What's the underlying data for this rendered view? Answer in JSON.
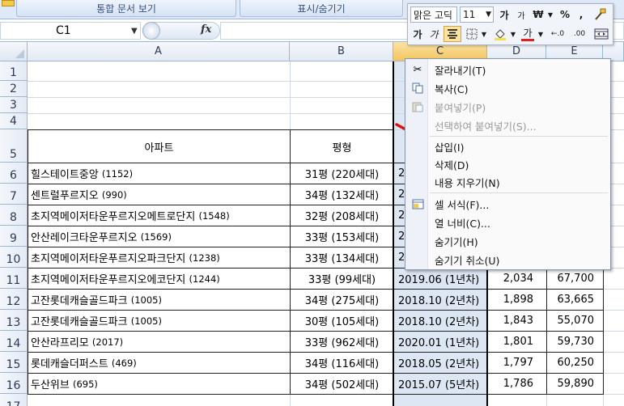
{
  "ribbon": {
    "btn_merge_docs": "통합 문서 보기",
    "btn_show_hide": "표시/숨기기"
  },
  "formula_bar": {
    "cell_ref": "C1",
    "fx": "fx",
    "formula": ""
  },
  "columns": [
    "A",
    "B",
    "C",
    "D",
    "E"
  ],
  "rows": [
    "1",
    "2",
    "3",
    "4",
    "5",
    "6",
    "7",
    "8",
    "9",
    "10",
    "11",
    "12",
    "13",
    "14",
    "15",
    "16",
    "17"
  ],
  "table": {
    "header_apt": "아파트",
    "header_size": "평형",
    "rows": [
      {
        "apt": "힐스테이트중앙",
        "count": "(1152)",
        "size": "31평 (220세대)",
        "date": "20",
        "d": "",
        "e": ""
      },
      {
        "apt": "센트럴푸르지오",
        "count": "(990)",
        "size": "34평 (132세대)",
        "date": "20",
        "d": "",
        "e": ""
      },
      {
        "apt": "초지역메이저타운푸르지오메트로단지",
        "count": "(1548)",
        "size": "32평 (208세대)",
        "date": "20",
        "d": "",
        "e": ""
      },
      {
        "apt": "안산레이크타운푸르지오",
        "count": "(1569)",
        "size": "33평 (153세대)",
        "date": "20",
        "d": "",
        "e": ""
      },
      {
        "apt": "초지역메이저타운푸르지오파크단지",
        "count": "(1238)",
        "size": "33평 (134세대)",
        "date": "20",
        "d": "",
        "e": ""
      },
      {
        "apt": "초지역메이저타운푸르지오에코단지",
        "count": "(1244)",
        "size": "33평 (99세대)",
        "date": "2019.06 (1년차)",
        "d": "2,034",
        "e": "67,700"
      },
      {
        "apt": "고잔롯데캐슬골드파크",
        "count": "(1005)",
        "size": "34평 (275세대)",
        "date": "2018.10 (2년차)",
        "d": "1,898",
        "e": "63,665"
      },
      {
        "apt": "고잔롯데캐슬골드파크",
        "count": "(1005)",
        "size": "30평 (105세대)",
        "date": "2018.10 (2년차)",
        "d": "1,843",
        "e": "55,070"
      },
      {
        "apt": "안산라프리모",
        "count": "(2017)",
        "size": "33평 (962세대)",
        "date": "2020.01 (1년차)",
        "d": "1,801",
        "e": "59,730"
      },
      {
        "apt": "롯데캐슬더퍼스트",
        "count": "(469)",
        "size": "34평 (116세대)",
        "date": "2018.05 (2년차)",
        "d": "1,797",
        "e": "60,250"
      },
      {
        "apt": "두산위브",
        "count": "(695)",
        "size": "34평 (502세대)",
        "date": "2015.07 (5년차)",
        "d": "1,786",
        "e": "59,890"
      }
    ]
  },
  "mini_toolbar": {
    "font_name": "맑은 고딕",
    "font_size": "11",
    "grow_font": "가",
    "shrink_font": "가",
    "currency": "₩",
    "percent": "%",
    "comma": ",",
    "bold": "가",
    "italic": "가",
    "font_color_glyph": "가",
    "inc_decimal": "←.0",
    "dec_decimal": ".00",
    "colors": {
      "font_color": "#e02020",
      "fill_color": "#f5e046"
    }
  },
  "context_menu": {
    "cut": "잘라내기(T)",
    "copy": "복사(C)",
    "paste": "붙여넣기(P)",
    "paste_special": "선택하여 붙여넣기(S)...",
    "insert": "삽입(I)",
    "delete": "삭제(D)",
    "clear": "내용 지우기(N)",
    "format_cells": "셀 서식(F)...",
    "column_width": "열 너비(C)...",
    "hide": "숨기기(H)",
    "unhide": "숨기기 취소(U)"
  }
}
